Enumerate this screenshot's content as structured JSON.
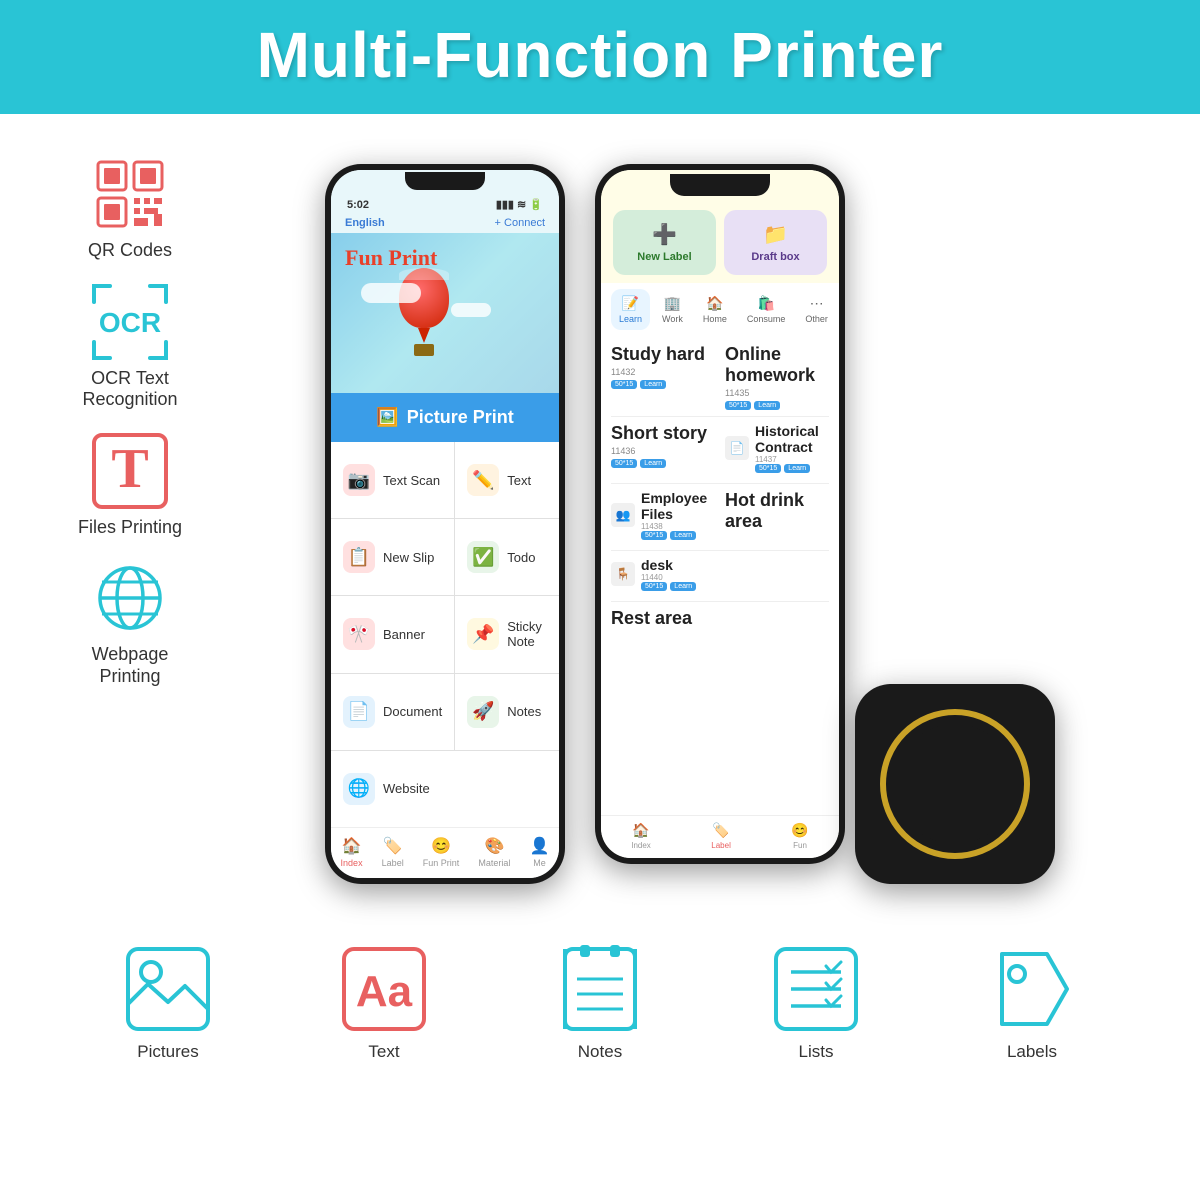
{
  "header": {
    "title": "Multi-Function Printer",
    "bg_color": "#29c4d5"
  },
  "left_features": [
    {
      "id": "qr-codes",
      "label": "QR Codes",
      "icon_type": "qr"
    },
    {
      "id": "ocr",
      "label": "OCR Text\nRecognition",
      "icon_type": "ocr"
    },
    {
      "id": "files",
      "label": "Files Printing",
      "icon_type": "T"
    },
    {
      "id": "webpage",
      "label": "Webpage\nPrinting",
      "icon_type": "globe"
    }
  ],
  "phone1": {
    "time": "5:02",
    "lang": "English",
    "connect": "+ Connect",
    "banner_title": "Fun Print",
    "picture_btn": "Picture Print",
    "menu_items": [
      {
        "icon": "📷",
        "label": "Text Scan"
      },
      {
        "icon": "✏️",
        "label": "Text"
      },
      {
        "icon": "📋",
        "label": "New Slip"
      },
      {
        "icon": "✅",
        "label": "Todo"
      },
      {
        "icon": "🎌",
        "label": "Banner"
      },
      {
        "icon": "📌",
        "label": "Sticky Note"
      },
      {
        "icon": "📄",
        "label": "Document"
      },
      {
        "icon": "🚀",
        "label": "Notes"
      },
      {
        "icon": "🌐",
        "label": "Website"
      },
      {
        "icon": "",
        "label": ""
      }
    ],
    "nav": [
      {
        "icon": "🏠",
        "label": "Index",
        "active": true
      },
      {
        "icon": "🏷️",
        "label": "Label"
      },
      {
        "icon": "😊",
        "label": "Fun Print"
      },
      {
        "icon": "🎨",
        "label": "Material"
      },
      {
        "icon": "👤",
        "label": "Me"
      }
    ]
  },
  "phone2": {
    "action_btns": [
      {
        "label": "New Label",
        "icon": "➕",
        "color": "green"
      },
      {
        "label": "Draft box",
        "icon": "📁",
        "color": "lavender"
      }
    ],
    "tabs": [
      {
        "icon": "📝",
        "label": "Learn",
        "active": true
      },
      {
        "icon": "🏢",
        "label": "Work"
      },
      {
        "icon": "🏠",
        "label": "Home"
      },
      {
        "icon": "🛍️",
        "label": "Consume"
      },
      {
        "icon": "⋯",
        "label": "Other"
      }
    ],
    "labels": [
      {
        "title": "Study hard",
        "sub": "11432",
        "tags": [
          "50*15",
          "Learn"
        ],
        "second_title": "Online homework",
        "second_sub": "11435",
        "second_tags": [
          "50*15",
          "Learn"
        ]
      },
      {
        "title": "Short story",
        "id": "11436",
        "tags": [
          "50*15",
          "Learn"
        ],
        "second_title": "Historical Contract",
        "second_id": "11437",
        "second_tags": [
          "50*15",
          "Learn"
        ]
      },
      {
        "title": "Employee Files",
        "id": "11438",
        "tags": [
          "50*15",
          "Learn"
        ],
        "second_title": "Hot drink area"
      },
      {
        "title": "desk",
        "id": "11440",
        "tags": [
          "50*15",
          "Learn"
        ]
      },
      {
        "title": "Rest area"
      }
    ],
    "nav": [
      {
        "icon": "🏠",
        "label": "Index"
      },
      {
        "icon": "🏷️",
        "label": "Label",
        "active": true
      },
      {
        "icon": "😊",
        "label": "Fun"
      }
    ]
  },
  "bottom_features": [
    {
      "id": "pictures",
      "label": "Pictures",
      "icon_type": "picture"
    },
    {
      "id": "text",
      "label": "Text",
      "icon_type": "text-aa"
    },
    {
      "id": "notes",
      "label": "Notes",
      "icon_type": "notes"
    },
    {
      "id": "lists",
      "label": "Lists",
      "icon_type": "lists"
    },
    {
      "id": "labels",
      "label": "Labels",
      "icon_type": "labels"
    }
  ]
}
